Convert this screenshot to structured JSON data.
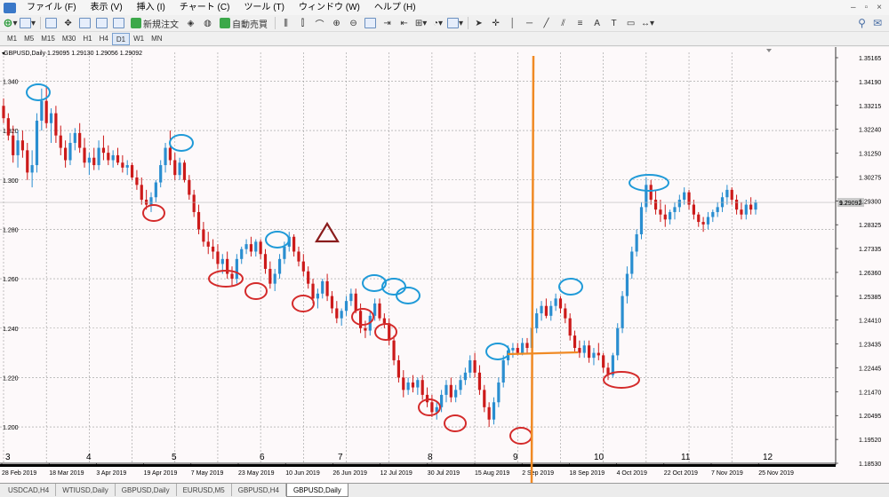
{
  "menubar": {
    "items": [
      "ファイル (F)",
      "表示 (V)",
      "挿入 (I)",
      "チャート (C)",
      "ツール (T)",
      "ウィンドウ (W)",
      "ヘルプ (H)"
    ]
  },
  "toolbar": {
    "new_order_label": "新規注文",
    "auto_trade_label": "自動売買"
  },
  "timeframes": {
    "items": [
      "M1",
      "M5",
      "M15",
      "M30",
      "H1",
      "H4",
      "D1",
      "W1",
      "MN"
    ],
    "active": "D1"
  },
  "chart": {
    "header": "GBPUSD,Daily  1.29095 1.29130 1.29056 1.29092",
    "current_price_label": "1.29092",
    "price_tag_label": "9.2",
    "price_ticks": [
      "1.35165",
      "1.34190",
      "1.33215",
      "1.32240",
      "1.31250",
      "1.30275",
      "1.29300",
      "1.28325",
      "1.27335",
      "1.26360",
      "1.25385",
      "1.24410",
      "1.23435",
      "1.22445",
      "1.21470",
      "1.20495",
      "1.19520",
      "1.18530"
    ],
    "left_labels": [
      "1.340",
      "1.320",
      "1.300",
      "1.280",
      "1.260",
      "1.240",
      "1.220",
      "1.200"
    ],
    "date_labels": [
      "28 Feb 2019",
      "18 Mar 2019",
      "3 Apr 2019",
      "19 Apr 2019",
      "7 May 2019",
      "23 May 2019",
      "10 Jun 2019",
      "26 Jun 2019",
      "12 Jul 2019",
      "30 Jul 2019",
      "15 Aug 2019",
      "2 Sep 2019",
      "18 Sep 2019",
      "4 Oct 2019",
      "22 Oct 2019",
      "7 Nov 2019",
      "25 Nov 2019"
    ],
    "wave_labels": [
      "3",
      "4",
      "5",
      "6",
      "7",
      "8",
      "9",
      "10",
      "11",
      "12"
    ],
    "colors": {
      "bull": "#2a8ed0",
      "bear": "#cc1a1a",
      "circle_high": "#1f9ad8",
      "circle_low": "#d42a2a",
      "orange": "#f08a24",
      "triangle": "#8a1c1c"
    }
  },
  "chart_data": {
    "type": "candlestick",
    "symbol": "GBPUSD",
    "timeframe": "Daily",
    "ylim": [
      1.1853,
      1.35165
    ],
    "candles": [
      [
        1.33,
        1.333,
        1.323,
        1.325
      ],
      [
        1.325,
        1.327,
        1.316,
        1.318
      ],
      [
        1.318,
        1.322,
        1.307,
        1.31
      ],
      [
        1.31,
        1.32,
        1.305,
        1.316
      ],
      [
        1.316,
        1.32,
        1.309,
        1.312
      ],
      [
        1.312,
        1.315,
        1.3,
        1.303
      ],
      [
        1.303,
        1.312,
        1.297,
        1.306
      ],
      [
        1.306,
        1.327,
        1.303,
        1.324
      ],
      [
        1.324,
        1.337,
        1.32,
        1.332
      ],
      [
        1.332,
        1.338,
        1.321,
        1.323
      ],
      [
        1.323,
        1.329,
        1.315,
        1.327
      ],
      [
        1.327,
        1.33,
        1.315,
        1.318
      ],
      [
        1.318,
        1.322,
        1.31,
        1.313
      ],
      [
        1.313,
        1.316,
        1.305,
        1.308
      ],
      [
        1.308,
        1.319,
        1.306,
        1.315
      ],
      [
        1.315,
        1.321,
        1.312,
        1.319
      ],
      [
        1.319,
        1.323,
        1.311,
        1.313
      ],
      [
        1.313,
        1.317,
        1.305,
        1.307
      ],
      [
        1.307,
        1.311,
        1.302,
        1.309
      ],
      [
        1.309,
        1.313,
        1.304,
        1.306
      ],
      [
        1.306,
        1.316,
        1.304,
        1.313
      ],
      [
        1.313,
        1.318,
        1.308,
        1.311
      ],
      [
        1.311,
        1.314,
        1.306,
        1.308
      ],
      [
        1.308,
        1.312,
        1.305,
        1.31
      ],
      [
        1.31,
        1.313,
        1.306,
        1.307
      ],
      [
        1.307,
        1.31,
        1.303,
        1.305
      ],
      [
        1.305,
        1.308,
        1.302,
        1.306
      ],
      [
        1.306,
        1.307,
        1.3,
        1.301
      ],
      [
        1.301,
        1.304,
        1.296,
        1.298
      ],
      [
        1.298,
        1.301,
        1.29,
        1.292
      ],
      [
        1.292,
        1.296,
        1.288,
        1.29
      ],
      [
        1.29,
        1.295,
        1.287,
        1.293
      ],
      [
        1.293,
        1.3,
        1.291,
        1.299
      ],
      [
        1.299,
        1.308,
        1.297,
        1.306
      ],
      [
        1.306,
        1.315,
        1.303,
        1.313
      ],
      [
        1.313,
        1.32,
        1.306,
        1.308
      ],
      [
        1.308,
        1.311,
        1.3,
        1.302
      ],
      [
        1.302,
        1.309,
        1.3,
        1.307
      ],
      [
        1.307,
        1.308,
        1.299,
        1.3
      ],
      [
        1.3,
        1.302,
        1.292,
        1.294
      ],
      [
        1.294,
        1.296,
        1.285,
        1.287
      ],
      [
        1.287,
        1.29,
        1.278,
        1.28
      ],
      [
        1.28,
        1.283,
        1.273,
        1.275
      ],
      [
        1.275,
        1.279,
        1.27,
        1.273
      ],
      [
        1.273,
        1.276,
        1.268,
        1.271
      ],
      [
        1.271,
        1.274,
        1.264,
        1.266
      ],
      [
        1.266,
        1.27,
        1.262,
        1.268
      ],
      [
        1.268,
        1.271,
        1.26,
        1.262
      ],
      [
        1.262,
        1.265,
        1.257,
        1.26
      ],
      [
        1.26,
        1.27,
        1.258,
        1.268
      ],
      [
        1.268,
        1.273,
        1.266,
        1.272
      ],
      [
        1.272,
        1.276,
        1.27,
        1.274
      ],
      [
        1.274,
        1.277,
        1.269,
        1.271
      ],
      [
        1.271,
        1.276,
        1.269,
        1.275
      ],
      [
        1.275,
        1.276,
        1.268,
        1.27
      ],
      [
        1.27,
        1.272,
        1.262,
        1.264
      ],
      [
        1.264,
        1.267,
        1.256,
        1.258
      ],
      [
        1.258,
        1.264,
        1.255,
        1.262
      ],
      [
        1.262,
        1.27,
        1.26,
        1.268
      ],
      [
        1.268,
        1.275,
        1.266,
        1.273
      ],
      [
        1.273,
        1.279,
        1.271,
        1.277
      ],
      [
        1.277,
        1.278,
        1.269,
        1.271
      ],
      [
        1.271,
        1.273,
        1.265,
        1.267
      ],
      [
        1.267,
        1.27,
        1.261,
        1.263
      ],
      [
        1.263,
        1.265,
        1.256,
        1.258
      ],
      [
        1.258,
        1.26,
        1.25,
        1.252
      ],
      [
        1.252,
        1.256,
        1.248,
        1.254
      ],
      [
        1.254,
        1.26,
        1.252,
        1.259
      ],
      [
        1.259,
        1.262,
        1.251,
        1.253
      ],
      [
        1.253,
        1.255,
        1.246,
        1.248
      ],
      [
        1.248,
        1.251,
        1.242,
        1.244
      ],
      [
        1.244,
        1.248,
        1.241,
        1.247
      ],
      [
        1.247,
        1.253,
        1.245,
        1.251
      ],
      [
        1.251,
        1.256,
        1.249,
        1.254
      ],
      [
        1.254,
        1.256,
        1.246,
        1.247
      ],
      [
        1.247,
        1.25,
        1.238,
        1.24
      ],
      [
        1.24,
        1.243,
        1.236,
        1.239
      ],
      [
        1.239,
        1.247,
        1.237,
        1.245
      ],
      [
        1.245,
        1.252,
        1.243,
        1.25
      ],
      [
        1.25,
        1.252,
        1.243,
        1.244
      ],
      [
        1.244,
        1.246,
        1.24,
        1.242
      ],
      [
        1.242,
        1.244,
        1.233,
        1.235
      ],
      [
        1.235,
        1.237,
        1.225,
        1.227
      ],
      [
        1.227,
        1.229,
        1.218,
        1.22
      ],
      [
        1.22,
        1.223,
        1.212,
        1.215
      ],
      [
        1.215,
        1.22,
        1.213,
        1.218
      ],
      [
        1.218,
        1.221,
        1.214,
        1.216
      ],
      [
        1.216,
        1.22,
        1.213,
        1.219
      ],
      [
        1.219,
        1.221,
        1.211,
        1.213
      ],
      [
        1.213,
        1.216,
        1.208,
        1.21
      ],
      [
        1.21,
        1.213,
        1.204,
        1.206
      ],
      [
        1.206,
        1.21,
        1.203,
        1.208
      ],
      [
        1.208,
        1.215,
        1.206,
        1.213
      ],
      [
        1.213,
        1.219,
        1.21,
        1.217
      ],
      [
        1.217,
        1.22,
        1.21,
        1.212
      ],
      [
        1.212,
        1.217,
        1.21,
        1.215
      ],
      [
        1.215,
        1.221,
        1.213,
        1.219
      ],
      [
        1.219,
        1.224,
        1.217,
        1.222
      ],
      [
        1.222,
        1.229,
        1.22,
        1.227
      ],
      [
        1.227,
        1.23,
        1.22,
        1.222
      ],
      [
        1.222,
        1.225,
        1.213,
        1.215
      ],
      [
        1.215,
        1.217,
        1.206,
        1.208
      ],
      [
        1.208,
        1.21,
        1.2,
        1.203
      ],
      [
        1.203,
        1.212,
        1.201,
        1.21
      ],
      [
        1.21,
        1.22,
        1.208,
        1.218
      ],
      [
        1.218,
        1.229,
        1.216,
        1.227
      ],
      [
        1.227,
        1.233,
        1.225,
        1.231
      ],
      [
        1.231,
        1.234,
        1.228,
        1.232
      ],
      [
        1.232,
        1.234,
        1.229,
        1.23
      ],
      [
        1.23,
        1.236,
        1.229,
        1.234
      ],
      [
        1.234,
        1.236,
        1.23,
        1.232
      ],
      [
        1.232,
        1.242,
        1.23,
        1.24
      ],
      [
        1.24,
        1.248,
        1.238,
        1.246
      ],
      [
        1.246,
        1.251,
        1.243,
        1.249
      ],
      [
        1.249,
        1.252,
        1.244,
        1.245
      ],
      [
        1.245,
        1.251,
        1.243,
        1.249
      ],
      [
        1.249,
        1.254,
        1.247,
        1.252
      ],
      [
        1.252,
        1.253,
        1.246,
        1.248
      ],
      [
        1.248,
        1.25,
        1.242,
        1.244
      ],
      [
        1.244,
        1.246,
        1.235,
        1.237
      ],
      [
        1.237,
        1.239,
        1.23,
        1.232
      ],
      [
        1.232,
        1.235,
        1.228,
        1.23
      ],
      [
        1.23,
        1.235,
        1.228,
        1.233
      ],
      [
        1.233,
        1.235,
        1.226,
        1.228
      ],
      [
        1.228,
        1.232,
        1.225,
        1.23
      ],
      [
        1.23,
        1.234,
        1.227,
        1.229
      ],
      [
        1.229,
        1.23,
        1.222,
        1.224
      ],
      [
        1.224,
        1.226,
        1.219,
        1.221
      ],
      [
        1.221,
        1.23,
        1.22,
        1.229
      ],
      [
        1.229,
        1.242,
        1.227,
        1.24
      ],
      [
        1.24,
        1.255,
        1.238,
        1.253
      ],
      [
        1.253,
        1.265,
        1.25,
        1.262
      ],
      [
        1.262,
        1.273,
        1.26,
        1.271
      ],
      [
        1.271,
        1.28,
        1.269,
        1.278
      ],
      [
        1.278,
        1.291,
        1.276,
        1.289
      ],
      [
        1.289,
        1.301,
        1.287,
        1.298
      ],
      [
        1.298,
        1.3,
        1.29,
        1.292
      ],
      [
        1.292,
        1.296,
        1.286,
        1.288
      ],
      [
        1.288,
        1.292,
        1.283,
        1.286
      ],
      [
        1.286,
        1.29,
        1.281,
        1.284
      ],
      [
        1.284,
        1.288,
        1.282,
        1.287
      ],
      [
        1.287,
        1.291,
        1.284,
        1.289
      ],
      [
        1.289,
        1.294,
        1.287,
        1.292
      ],
      [
        1.292,
        1.297,
        1.29,
        1.295
      ],
      [
        1.295,
        1.296,
        1.288,
        1.29
      ],
      [
        1.29,
        1.292,
        1.284,
        1.286
      ],
      [
        1.286,
        1.287,
        1.281,
        1.283
      ],
      [
        1.283,
        1.285,
        1.279,
        1.282
      ],
      [
        1.282,
        1.287,
        1.28,
        1.285
      ],
      [
        1.285,
        1.288,
        1.283,
        1.287
      ],
      [
        1.287,
        1.291,
        1.285,
        1.289
      ],
      [
        1.289,
        1.295,
        1.287,
        1.293
      ],
      [
        1.293,
        1.298,
        1.29,
        1.296
      ],
      [
        1.296,
        1.297,
        1.29,
        1.292
      ],
      [
        1.292,
        1.294,
        1.286,
        1.288
      ],
      [
        1.288,
        1.291,
        1.284,
        1.286
      ],
      [
        1.286,
        1.292,
        1.284,
        1.29
      ],
      [
        1.29,
        1.293,
        1.286,
        1.288
      ],
      [
        1.288,
        1.292,
        1.286,
        1.2909
      ]
    ]
  }
}
